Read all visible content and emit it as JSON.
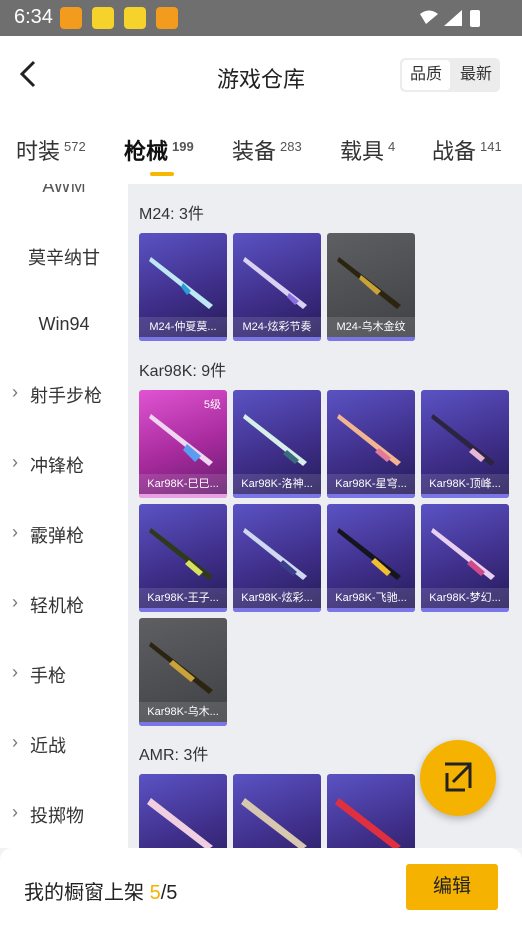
{
  "status_bar": {
    "time": "6:34",
    "app_icons": [
      "app-icon",
      "app-icon",
      "app-icon",
      "app-icon"
    ],
    "right_icons": [
      "wifi-icon",
      "signal-icon",
      "battery-icon"
    ]
  },
  "header": {
    "title": "游戏仓库",
    "sort": {
      "quality_label": "品质",
      "latest_label": "最新"
    }
  },
  "tabs": [
    {
      "label": "时装",
      "count": "572"
    },
    {
      "label": "枪械",
      "count": "199"
    },
    {
      "label": "装备",
      "count": "283"
    },
    {
      "label": "载具",
      "count": "4"
    },
    {
      "label": "战备",
      "count": "141"
    }
  ],
  "sidebar": {
    "items": [
      {
        "label": "AWM",
        "expandable": false
      },
      {
        "label": "莫辛纳甘",
        "expandable": false
      },
      {
        "label": "Win94",
        "expandable": false
      },
      {
        "label": "射手步枪",
        "expandable": true
      },
      {
        "label": "冲锋枪",
        "expandable": true
      },
      {
        "label": "霰弹枪",
        "expandable": true
      },
      {
        "label": "轻机枪",
        "expandable": true
      },
      {
        "label": "手枪",
        "expandable": true
      },
      {
        "label": "近战",
        "expandable": true
      },
      {
        "label": "投掷物",
        "expandable": true
      }
    ]
  },
  "groups": [
    {
      "title": "M24: 3件",
      "items": [
        {
          "name": "M24-仲夏莫...",
          "rarity": "purple"
        },
        {
          "name": "M24-炫彩节奏",
          "rarity": "purple"
        },
        {
          "name": "M24-乌木金纹",
          "rarity": "gray"
        }
      ]
    },
    {
      "title": "Kar98K: 9件",
      "items": [
        {
          "name": "Kar98K-巳巳...",
          "rarity": "pink",
          "level": "5级"
        },
        {
          "name": "Kar98K-洛神...",
          "rarity": "purple"
        },
        {
          "name": "Kar98K-星穹...",
          "rarity": "purple"
        },
        {
          "name": "Kar98K-顶峰...",
          "rarity": "purple"
        },
        {
          "name": "Kar98K-王子...",
          "rarity": "purple"
        },
        {
          "name": "Kar98K-炫彩...",
          "rarity": "purple"
        },
        {
          "name": "Kar98K-飞驰...",
          "rarity": "purple"
        },
        {
          "name": "Kar98K-梦幻...",
          "rarity": "purple"
        },
        {
          "name": "Kar98K-乌木...",
          "rarity": "gray"
        }
      ]
    },
    {
      "title": "AMR: 3件",
      "items": [
        {
          "name": "",
          "rarity": "purple"
        },
        {
          "name": "",
          "rarity": "purple"
        },
        {
          "name": "",
          "rarity": "purple"
        }
      ]
    }
  ],
  "bottom_bar": {
    "shelf_label": "我的橱窗上架",
    "count_current": "5",
    "count_total": "/5",
    "edit_label": "编辑"
  },
  "colors": {
    "accent": "#f5b200",
    "rare_purple": "#4a3fa8",
    "legend_pink": "#c23cb8",
    "common_gray": "#505155"
  }
}
